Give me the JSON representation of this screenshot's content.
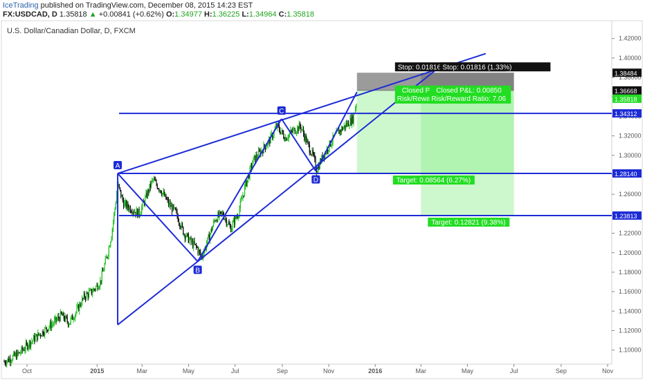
{
  "header": {
    "brand": "IceTrading",
    "published": "published on TradingView.com, December 08, 2015 14:23 EST",
    "symbol": "FX:USDCAD, D",
    "last": "1.35818",
    "change_arrow": "▲",
    "change": "+0.00841 (+0.62%)",
    "o_label": "O:",
    "o_value": "1.34977",
    "h_label": "H:",
    "h_value": "1.36225",
    "l_label": "L:",
    "l_value": "1.34964",
    "c_label": "C:",
    "c_value": "1.35818"
  },
  "chart_data": {
    "type": "candlestick",
    "title": "U.S. Dollar/Canadian Dollar, D, FXCM",
    "x_tick_labels": [
      "Oct",
      "2015",
      "Mar",
      "May",
      "Jul",
      "Sep",
      "Nov",
      "2016",
      "Mar",
      "May",
      "Jul",
      "Sep",
      "Nov"
    ],
    "y_tick_labels": [
      "1.42000",
      "1.40000",
      "1.38000",
      "1.36000",
      "1.34000",
      "1.32000",
      "1.30000",
      "1.28000",
      "1.26000",
      "1.24000",
      "1.22000",
      "1.20000",
      "1.18000",
      "1.16000",
      "1.14000",
      "1.12000",
      "1.10000"
    ],
    "y_ticks": [
      1.42,
      1.4,
      1.38,
      1.36,
      1.34,
      1.32,
      1.3,
      1.28,
      1.26,
      1.24,
      1.22,
      1.2,
      1.18,
      1.16,
      1.14,
      1.12,
      1.1
    ],
    "ylim": [
      1.087,
      1.434
    ],
    "grid": false,
    "price_path": [
      [
        "2014-09-01",
        1.088
      ],
      [
        "2014-09-20",
        1.096
      ],
      [
        "2014-10-05",
        1.108
      ],
      [
        "2014-10-20",
        1.118
      ],
      [
        "2014-11-05",
        1.128
      ],
      [
        "2014-11-15",
        1.136
      ],
      [
        "2014-11-25",
        1.128
      ],
      [
        "2014-12-05",
        1.14
      ],
      [
        "2014-12-15",
        1.155
      ],
      [
        "2014-12-25",
        1.16
      ],
      [
        "2015-01-05",
        1.17
      ],
      [
        "2015-01-10",
        1.185
      ],
      [
        "2015-01-15",
        1.2
      ],
      [
        "2015-01-20",
        1.22
      ],
      [
        "2015-01-25",
        1.25
      ],
      [
        "2015-01-28",
        1.27
      ],
      [
        "2015-02-05",
        1.25
      ],
      [
        "2015-02-15",
        1.245
      ],
      [
        "2015-02-25",
        1.24
      ],
      [
        "2015-03-05",
        1.255
      ],
      [
        "2015-03-15",
        1.275
      ],
      [
        "2015-03-25",
        1.265
      ],
      [
        "2015-04-05",
        1.25
      ],
      [
        "2015-04-15",
        1.24
      ],
      [
        "2015-04-25",
        1.22
      ],
      [
        "2015-05-05",
        1.21
      ],
      [
        "2015-05-12",
        1.205
      ],
      [
        "2015-05-18",
        1.195
      ],
      [
        "2015-05-25",
        1.21
      ],
      [
        "2015-06-05",
        1.235
      ],
      [
        "2015-06-15",
        1.24
      ],
      [
        "2015-06-25",
        1.225
      ],
      [
        "2015-07-05",
        1.24
      ],
      [
        "2015-07-15",
        1.27
      ],
      [
        "2015-07-25",
        1.295
      ],
      [
        "2015-08-05",
        1.305
      ],
      [
        "2015-08-15",
        1.315
      ],
      [
        "2015-08-25",
        1.33
      ],
      [
        "2015-09-05",
        1.318
      ],
      [
        "2015-09-15",
        1.325
      ],
      [
        "2015-09-25",
        1.33
      ],
      [
        "2015-10-05",
        1.31
      ],
      [
        "2015-10-12",
        1.298
      ],
      [
        "2015-10-16",
        1.285
      ],
      [
        "2015-10-25",
        1.3
      ],
      [
        "2015-11-05",
        1.315
      ],
      [
        "2015-11-15",
        1.325
      ],
      [
        "2015-11-25",
        1.332
      ],
      [
        "2015-12-03",
        1.338
      ],
      [
        "2015-12-08",
        1.358
      ]
    ],
    "current_price": 1.35818,
    "pattern_points": [
      {
        "label": "A",
        "date": "2015-01-28",
        "price": 1.2814
      },
      {
        "label": "B",
        "date": "2015-05-13",
        "price": 1.191
      },
      {
        "label": "C",
        "date": "2015-08-31",
        "price": 1.3375
      },
      {
        "label": "D",
        "date": "2015-10-15",
        "price": 1.2838
      }
    ],
    "horizontal_levels": [
      1.34312,
      1.2814,
      1.23813
    ],
    "level_labels": [
      "1.34312",
      "1.28140",
      "1.23813"
    ],
    "price_scale_labels": [
      {
        "value": 1.38484,
        "text": "1.38484",
        "style": "dark"
      },
      {
        "value": 1.36668,
        "text": "1.36668",
        "style": "dark"
      },
      {
        "value": 1.35818,
        "text": "1.35818",
        "style": "green"
      }
    ],
    "trendlines": [
      {
        "from": [
          "2015-01-28",
          1.2814
        ],
        "to": [
          "2016-05-25",
          1.4045
        ]
      },
      {
        "from": [
          "2015-05-13",
          1.191
        ],
        "to": [
          "2016-04-01",
          1.395
        ]
      },
      {
        "from": [
          "2015-01-28",
          1.2814
        ],
        "to": [
          "2015-05-13",
          1.191
        ]
      },
      {
        "from": [
          "2015-05-13",
          1.191
        ],
        "to": [
          "2015-08-31",
          1.3375
        ]
      },
      {
        "from": [
          "2015-08-31",
          1.3375
        ],
        "to": [
          "2015-10-15",
          1.2838
        ]
      },
      {
        "from": [
          "2015-10-15",
          1.2838
        ],
        "to": [
          "2015-12-08",
          1.365
        ]
      },
      {
        "from": [
          "2015-01-28",
          1.2814
        ],
        "to": [
          "2015-01-28",
          1.126
        ]
      },
      {
        "from": [
          "2015-01-28",
          1.126
        ],
        "to": [
          "2015-05-13",
          1.191
        ]
      }
    ],
    "positions": [
      {
        "from": "2015-12-08",
        "to": "2016-07-01",
        "entry": 1.36668,
        "stop": 1.38484,
        "target": 1.2814,
        "stop_label": "Stop: 0.01816 (1.33%)",
        "pnl_label": "Closed P&L: 0.00850",
        "rr_label": "Risk/Reward Ratio: 7.06",
        "target_label": "Target: 0.08564 (6.27%)"
      },
      {
        "from": "2016-03-01",
        "to": "2016-07-01",
        "entry": 1.36668,
        "stop": 1.38484,
        "target": 1.23813,
        "stop_label": "Stop: 0.01816 (1.33%)",
        "pnl_label": "Closed P&L: 0.00850",
        "rr_label": "Risk/Reward Ratio: 7.06",
        "target_label": "Target: 0.12821 (9.38%)"
      }
    ]
  },
  "colors": {
    "pattern_line": "#1c2bd6",
    "up_candle": "#1fbf1f",
    "down_candle": "#111111",
    "target_zone": "#90ee90",
    "stop_zone": "#7a7a7a",
    "label_green": "#22dd22",
    "label_dark": "#111111"
  }
}
